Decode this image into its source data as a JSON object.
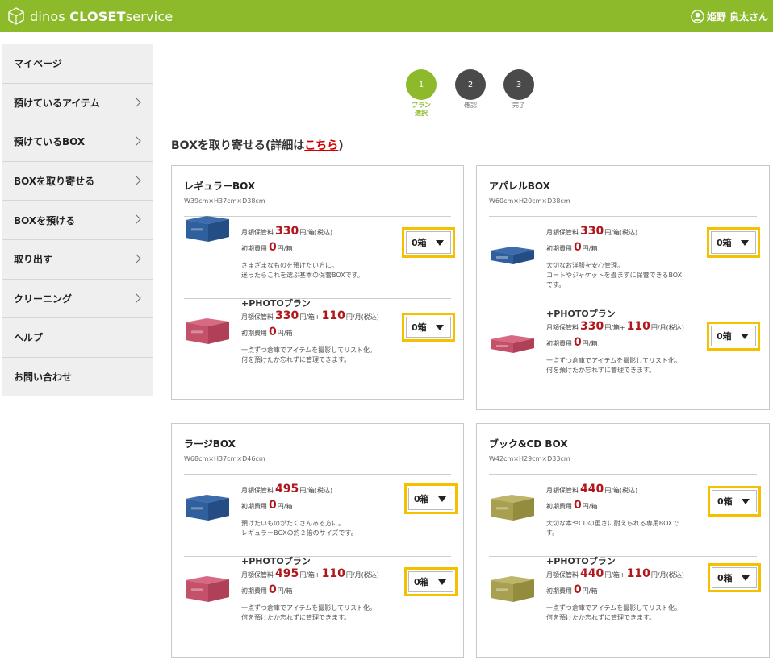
{
  "header": {
    "logo_prefix": "dinos",
    "logo_brand": "CLOSET",
    "logo_suffix": "service",
    "user_name": "姫野 良太さん",
    "accent_color": "#8cba2b"
  },
  "sidebar": {
    "items": [
      {
        "label": "マイページ",
        "has_arrow": false
      },
      {
        "label": "預けているアイテム",
        "has_arrow": true
      },
      {
        "label": "預けているBOX",
        "has_arrow": true
      },
      {
        "label": "BOXを取り寄せる",
        "has_arrow": true
      },
      {
        "label": "BOXを預ける",
        "has_arrow": true
      },
      {
        "label": "取り出す",
        "has_arrow": true
      },
      {
        "label": "クリーニング",
        "has_arrow": true
      },
      {
        "label": "ヘルプ",
        "has_arrow": false
      },
      {
        "label": "お問い合わせ",
        "has_arrow": false
      }
    ]
  },
  "steps": [
    {
      "num": "1",
      "label1": "プラン",
      "label2": "選択",
      "active": true
    },
    {
      "num": "2",
      "label1": "確認",
      "label2": "",
      "active": false
    },
    {
      "num": "3",
      "label1": "完了",
      "label2": "",
      "active": false
    }
  ],
  "section": {
    "title_prefix": "BOXを取り寄せる(詳細は",
    "title_link": "こちら",
    "title_suffix": ")"
  },
  "labels": {
    "monthly": "月額保管料",
    "initial": "初期費用",
    "per_box_tax": "円/箱(税込)",
    "per_box_plus": "円/箱+",
    "per_month_tax": "円/月(税込)",
    "yen_per_box": "円/箱",
    "photo_plan": "+PHOTOプラン",
    "photo_desc1": "一点ずつ倉庫でアイテムを撮影してリスト化。",
    "photo_desc2": "何を預けたか忘れずに管理できます。",
    "photo_fee": "110",
    "initial_fee": "0",
    "select_value": "0箱"
  },
  "cards": [
    {
      "title": "レギュラーBOX",
      "dims": "W39cm×H37cm×D38cm",
      "price": "330",
      "desc": [
        "さまざまなものを預けたい方に。",
        "迷ったらこれを選ぶ基本の保管BOXです。"
      ],
      "box_color": "blue"
    },
    {
      "title": "アパレルBOX",
      "dims": "W60cm×H20cm×D38cm",
      "price": "330",
      "desc": [
        "大切なお洋服を安心管理。",
        "コートやジャケットを畳まずに保管できるBOX",
        "です。"
      ],
      "box_color": "blue-flat"
    },
    {
      "title": "ラージBOX",
      "dims": "W68cm×H37cm×D46cm",
      "price": "495",
      "desc": [
        "預けたいものがたくさんある方に。",
        "レギュラーBOXの約２倍のサイズです。"
      ],
      "box_color": "blue"
    },
    {
      "title": "ブック&CD BOX",
      "dims": "W42cm×H29cm×D33cm",
      "price": "440",
      "desc": [
        "大切な本やCDの重さに耐えられる専用BOXで",
        "す。"
      ],
      "box_color": "olive"
    }
  ],
  "colors": {
    "blue": "#2f5f9c",
    "pink": "#c4506a",
    "olive": "#a8a050",
    "price_red": "#b0171c",
    "select_highlight": "#f5c000"
  }
}
